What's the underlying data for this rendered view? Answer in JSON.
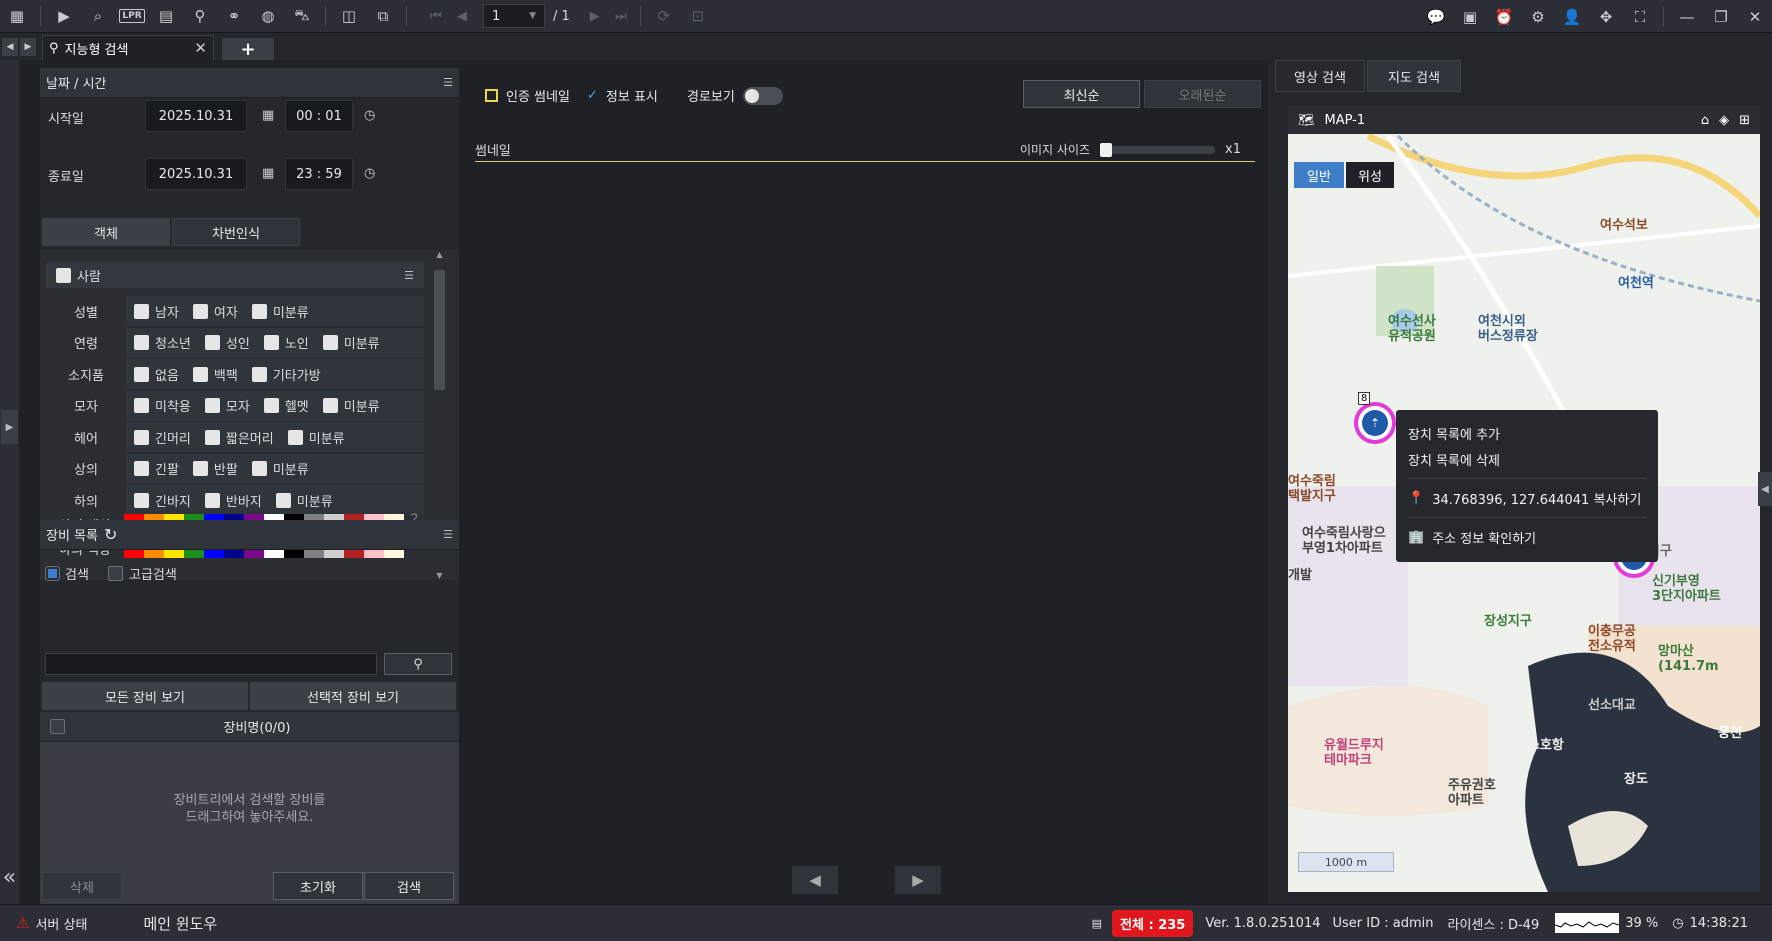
{
  "toolbar": {
    "icons": [
      "grid-icon",
      "play-icon",
      "search-video-icon",
      "lpr-icon",
      "calendar-list-icon",
      "person-search-icon",
      "bike-icon",
      "globe-search-icon",
      "car-search-icon",
      "layout-icon",
      "screen-settings-icon"
    ],
    "lpr_label": "LPR",
    "page_current": "1",
    "page_total": "/ 1",
    "right_icons": [
      "chat-icon",
      "monitor-icon",
      "alarm-icon",
      "gear-icon",
      "user-icon",
      "move-icon",
      "fullscreen-icon",
      "minimize-icon",
      "restore-icon",
      "close-icon"
    ]
  },
  "tab": {
    "title": "지능형 검색"
  },
  "left": {
    "datetime_title": "날짜 / 시간",
    "start_label": "시작일",
    "start_date": "2025.10.31",
    "start_time": "00 : 01",
    "end_label": "종료일",
    "end_date": "2025.10.31",
    "end_time": "23 : 59",
    "tab_object": "객체",
    "tab_lpr": "차번인식",
    "person": "사람",
    "filters": [
      {
        "label": "성별",
        "options": [
          "남자",
          "여자",
          "미분류"
        ]
      },
      {
        "label": "연령",
        "options": [
          "청소년",
          "성인",
          "노인",
          "미분류"
        ]
      },
      {
        "label": "소지품",
        "options": [
          "없음",
          "백팩",
          "기타가방"
        ]
      },
      {
        "label": "모자",
        "options": [
          "미착용",
          "모자",
          "헬멧",
          "미분류"
        ]
      },
      {
        "label": "헤어",
        "options": [
          "긴머리",
          "짧은머리",
          "미분류"
        ]
      },
      {
        "label": "상의",
        "options": [
          "긴팔",
          "반팔",
          "미분류"
        ]
      },
      {
        "label": "하의",
        "options": [
          "긴바지",
          "반바지",
          "미분류"
        ]
      }
    ],
    "top_color_label": "상의 색상",
    "bottom_color_label": "하의 색상",
    "colors": [
      "#ff0000",
      "#ff8c00",
      "#ffe600",
      "#1a8f1a",
      "#0000ff",
      "#00008b",
      "#7a0a8a",
      "#ffffff",
      "#000000",
      "#808080",
      "#cfcfcf",
      "#b22222",
      "#ffc0cb",
      "#fff8dc"
    ],
    "unknown_color": "?",
    "device_title": "장비 목록",
    "search_opt": "검색",
    "adv_search_opt": "고급검색",
    "view_all": "모든 장비 보기",
    "view_selected": "선택적 장비 보기",
    "device_name_header": "장비명(0/0)",
    "drop_msg_1": "장비트리에서 검색할 장비를",
    "drop_msg_2": "드래그하여 놓아주세요.",
    "delete_btn": "삭제",
    "reset_btn": "초기화",
    "search_btn": "검색"
  },
  "middle": {
    "cert_thumb": "인증 썸네일",
    "info_show": "정보 표시",
    "route_view": "경로보기",
    "newest": "최신순",
    "oldest": "오래된순",
    "thumb_label": "썸네일",
    "image_size_label": "이미지 사이즈",
    "image_size_value": "x1"
  },
  "right": {
    "tab_video": "영상 검색",
    "tab_map": "지도 검색",
    "map_title": "MAP-1",
    "normal": "일반",
    "satellite": "위성",
    "labels": [
      {
        "text": "여수석보"
      },
      {
        "text": "여천역"
      },
      {
        "text": "여수선사\n유적공원"
      },
      {
        "text": "여천시외\n버스정류장"
      },
      {
        "text": "여수죽림\n택발지구"
      },
      {
        "text": "여수죽림사랑으\n부영1차아파트"
      },
      {
        "text": "여수지구"
      },
      {
        "text": "신기부영\n3단지아파트"
      },
      {
        "text": "장성지구"
      },
      {
        "text": "이충무공\n전소유적"
      },
      {
        "text": "망마산\n(141.7m"
      },
      {
        "text": "선소대교"
      },
      {
        "text": "유월드루지\n테마파크"
      },
      {
        "text": "소호항"
      },
      {
        "text": "주유권호\n아파트"
      },
      {
        "text": "장도"
      },
      {
        "text": "웅천"
      },
      {
        "text": "개발"
      }
    ],
    "marker_count": "8",
    "ctx_add": "장치 목록에 추가",
    "ctx_remove": "장치 목록에 삭제",
    "ctx_coords": "34.768396, 127.644041 복사하기",
    "ctx_address": "주소 정보 확인하기",
    "scale": "1000 m"
  },
  "status": {
    "server_status": "서버 상태",
    "main_window": "메인 윈도우",
    "total": "전체 : 235",
    "version": "Ver. 1.8.0.251014",
    "user": "User ID : admin",
    "license": "라이센스 : D-49",
    "cpu": "39 %",
    "clock": "14:38:21"
  }
}
